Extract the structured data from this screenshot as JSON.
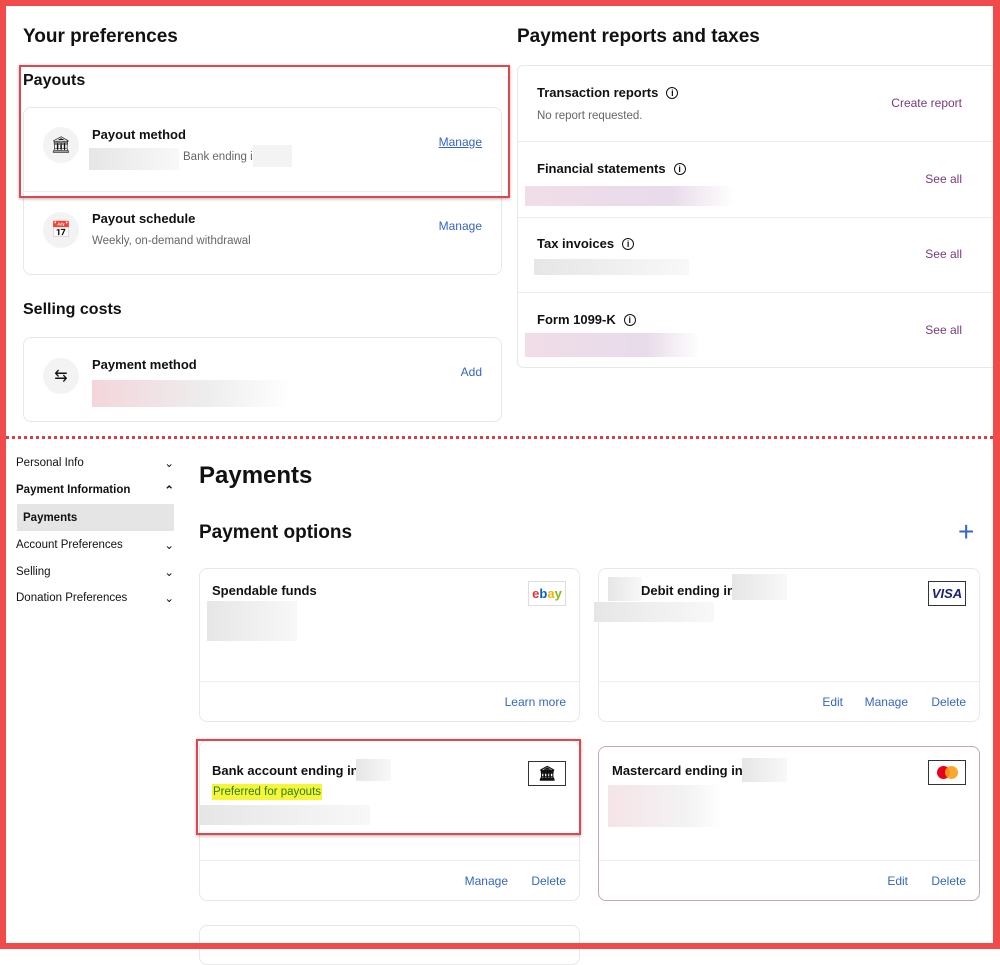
{
  "preferences": {
    "title": "Your preferences",
    "payouts": {
      "title": "Payouts",
      "method": {
        "label": "Payout method",
        "detail": "Bank ending ir",
        "action": "Manage",
        "icon": "bank-icon"
      },
      "schedule": {
        "label": "Payout schedule",
        "detail": "Weekly, on-demand withdrawal",
        "action": "Manage",
        "icon": "calendar-icon"
      }
    },
    "selling": {
      "title": "Selling costs",
      "method": {
        "label": "Payment method",
        "action": "Add",
        "icon": "swap-icon"
      }
    }
  },
  "reports": {
    "title": "Payment reports and taxes",
    "items": [
      {
        "label": "Transaction reports",
        "detail": "No report requested.",
        "action": "Create report"
      },
      {
        "label": "Financial statements",
        "action": "See all"
      },
      {
        "label": "Tax invoices",
        "action": "See all"
      },
      {
        "label": "Form 1099-K",
        "action": "See all"
      }
    ]
  },
  "sidebar": {
    "items": [
      {
        "label": "Personal Info",
        "chevron": "chevron-down"
      },
      {
        "label": "Payment Information",
        "chevron": "chevron-up"
      },
      {
        "label": "Payments",
        "selected": true
      },
      {
        "label": "Account Preferences",
        "chevron": "chevron-down"
      },
      {
        "label": "Selling",
        "chevron": "chevron-down"
      },
      {
        "label": "Donation Preferences",
        "chevron": "chevron-down"
      }
    ]
  },
  "payments": {
    "title": "Payments",
    "options_title": "Payment options",
    "add_icon": "+",
    "cards": [
      {
        "title": "Spendable funds",
        "logo": "ebay",
        "actions": [
          "Learn more"
        ]
      },
      {
        "title": "Debit ending in",
        "logo": "VISA",
        "actions": [
          "Edit",
          "Manage",
          "Delete"
        ]
      },
      {
        "title": "Bank account ending in",
        "badge": "Preferred for payouts",
        "logo": "bank",
        "actions": [
          "Manage",
          "Delete"
        ]
      },
      {
        "title": "Mastercard ending in",
        "logo": "mastercard",
        "actions": [
          "Edit",
          "Delete"
        ]
      }
    ]
  },
  "colors": {
    "frame": "#f04a4a",
    "link": "#3665c3",
    "report_link": "#7a3a7a",
    "badge_bg": "#f5f53a",
    "badge_text": "#2e7d1a"
  }
}
